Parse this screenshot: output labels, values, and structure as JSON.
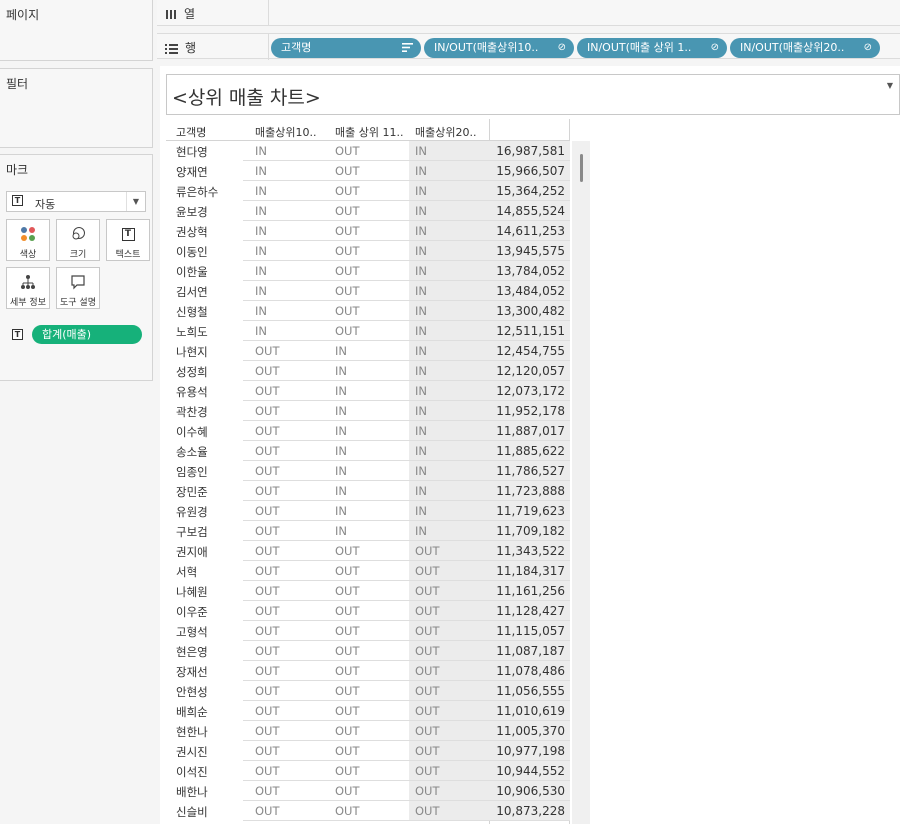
{
  "left_panel": {
    "pages_title": "페이지",
    "filters_title": "필터",
    "marks": {
      "title": "마크",
      "mark_type": "자동",
      "buttons": [
        {
          "label": "색상",
          "icon": "color-icon"
        },
        {
          "label": "크기",
          "icon": "size-icon"
        },
        {
          "label": "텍스트",
          "icon": "text-icon"
        },
        {
          "label": "세부 정보",
          "icon": "detail-icon"
        },
        {
          "label": "도구 설명",
          "icon": "tooltip-icon"
        }
      ],
      "text_field": "합계(매출)"
    }
  },
  "shelves": {
    "columns_label": "열",
    "rows_label": "행",
    "row_pills": [
      {
        "label": "고객명",
        "icon": "sort-icon"
      },
      {
        "label": "IN/OUT(매출상위10..",
        "icon": "set-icon"
      },
      {
        "label": "IN/OUT(매출 상위 1..",
        "icon": "set-icon"
      },
      {
        "label": "IN/OUT(매출상위20..",
        "icon": "set-icon"
      }
    ]
  },
  "worksheet": {
    "title": "<상위 매출 차트>",
    "headers": [
      "고객명",
      "매출상위10..",
      "매출 상위 11..",
      "매출상위20.."
    ],
    "rows": [
      [
        "현다영",
        "IN",
        "OUT",
        "IN",
        "16,987,581"
      ],
      [
        "양재연",
        "IN",
        "OUT",
        "IN",
        "15,966,507"
      ],
      [
        "류은하수",
        "IN",
        "OUT",
        "IN",
        "15,364,252"
      ],
      [
        "윤보경",
        "IN",
        "OUT",
        "IN",
        "14,855,524"
      ],
      [
        "권상혁",
        "IN",
        "OUT",
        "IN",
        "14,611,253"
      ],
      [
        "이동인",
        "IN",
        "OUT",
        "IN",
        "13,945,575"
      ],
      [
        "이한울",
        "IN",
        "OUT",
        "IN",
        "13,784,052"
      ],
      [
        "김서연",
        "IN",
        "OUT",
        "IN",
        "13,484,052"
      ],
      [
        "신형철",
        "IN",
        "OUT",
        "IN",
        "13,300,482"
      ],
      [
        "노희도",
        "IN",
        "OUT",
        "IN",
        "12,511,151"
      ],
      [
        "나현지",
        "OUT",
        "IN",
        "IN",
        "12,454,755"
      ],
      [
        "성정희",
        "OUT",
        "IN",
        "IN",
        "12,120,057"
      ],
      [
        "유용석",
        "OUT",
        "IN",
        "IN",
        "12,073,172"
      ],
      [
        "곽찬경",
        "OUT",
        "IN",
        "IN",
        "11,952,178"
      ],
      [
        "이수혜",
        "OUT",
        "IN",
        "IN",
        "11,887,017"
      ],
      [
        "송소율",
        "OUT",
        "IN",
        "IN",
        "11,885,622"
      ],
      [
        "임종인",
        "OUT",
        "IN",
        "IN",
        "11,786,527"
      ],
      [
        "장민준",
        "OUT",
        "IN",
        "IN",
        "11,723,888"
      ],
      [
        "유원경",
        "OUT",
        "IN",
        "IN",
        "11,719,623"
      ],
      [
        "구보검",
        "OUT",
        "IN",
        "IN",
        "11,709,182"
      ],
      [
        "권지애",
        "OUT",
        "OUT",
        "OUT",
        "11,343,522"
      ],
      [
        "서혁",
        "OUT",
        "OUT",
        "OUT",
        "11,184,317"
      ],
      [
        "나혜원",
        "OUT",
        "OUT",
        "OUT",
        "11,161,256"
      ],
      [
        "이우준",
        "OUT",
        "OUT",
        "OUT",
        "11,128,427"
      ],
      [
        "고형석",
        "OUT",
        "OUT",
        "OUT",
        "11,115,057"
      ],
      [
        "현은영",
        "OUT",
        "OUT",
        "OUT",
        "11,087,187"
      ],
      [
        "장재선",
        "OUT",
        "OUT",
        "OUT",
        "11,078,486"
      ],
      [
        "안현성",
        "OUT",
        "OUT",
        "OUT",
        "11,056,555"
      ],
      [
        "배희순",
        "OUT",
        "OUT",
        "OUT",
        "11,010,619"
      ],
      [
        "현한나",
        "OUT",
        "OUT",
        "OUT",
        "11,005,370"
      ],
      [
        "권시진",
        "OUT",
        "OUT",
        "OUT",
        "10,977,198"
      ],
      [
        "이석진",
        "OUT",
        "OUT",
        "OUT",
        "10,944,552"
      ],
      [
        "배한나",
        "OUT",
        "OUT",
        "OUT",
        "10,906,530"
      ],
      [
        "신슬비",
        "OUT",
        "OUT",
        "OUT",
        "10,873,228"
      ]
    ]
  }
}
